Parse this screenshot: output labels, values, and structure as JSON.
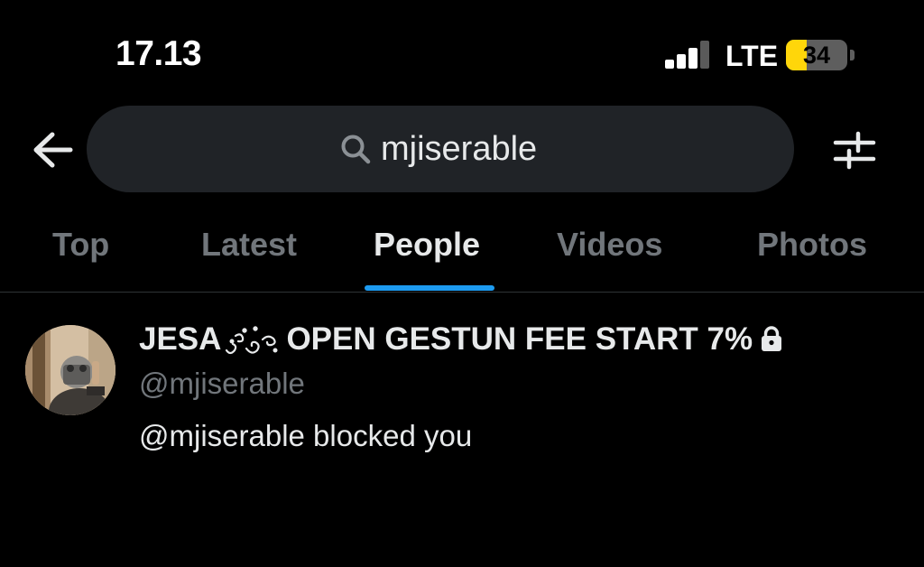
{
  "status_bar": {
    "time": "17.13",
    "network": "LTE",
    "battery_level": "34",
    "battery_fraction": 0.34,
    "signal_bars_active": 3,
    "signal_bars_total": 4
  },
  "search": {
    "query": "mjiserable",
    "icons": {
      "back": "arrow-left-icon",
      "search": "search-icon",
      "filter": "filter-sliders-icon"
    }
  },
  "tabs": [
    {
      "label": "Top",
      "active": false
    },
    {
      "label": "Latest",
      "active": false
    },
    {
      "label": "People",
      "active": true
    },
    {
      "label": "Videos",
      "active": false
    },
    {
      "label": "Photos",
      "active": false
    }
  ],
  "result": {
    "display_name_prefix": "JESA",
    "display_name_suffix": "OPEN GESTUN FEE START 7%",
    "handle": "@mjiserable",
    "status_text": "@mjiserable blocked you",
    "protected_icon": "lock-icon"
  },
  "colors": {
    "background": "#000000",
    "primary_text": "#e7e9ea",
    "secondary_text": "#71767b",
    "accent": "#1d9bf0",
    "search_bg": "#202327",
    "battery_fill": "#ffd60a"
  }
}
